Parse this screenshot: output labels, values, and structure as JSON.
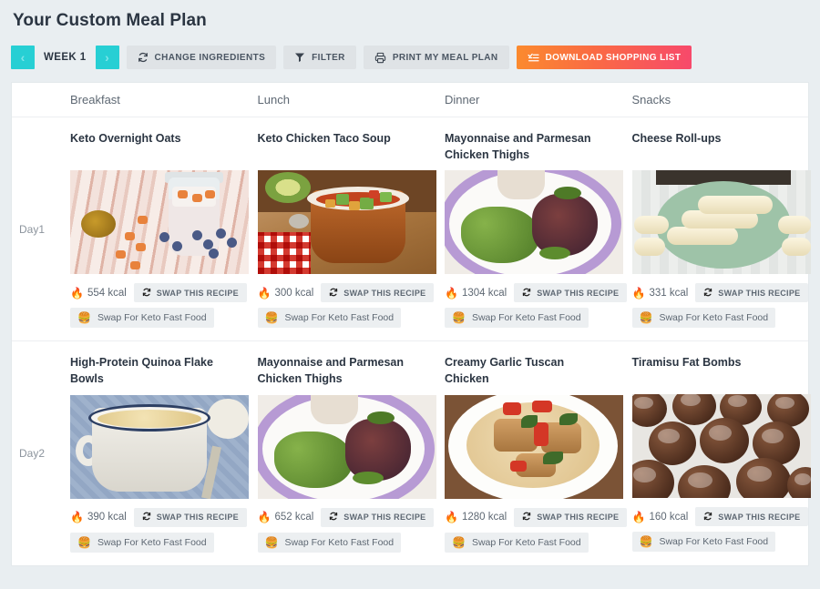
{
  "header": {
    "title": "Your Custom Meal Plan"
  },
  "toolbar": {
    "prev_label": "‹",
    "next_label": "›",
    "week_label": "WEEK 1",
    "change_ingredients_label": "CHANGE INGREDIENTS",
    "filter_label": "FILTER",
    "print_label": "PRINT MY MEAL PLAN",
    "download_label": "DOWNLOAD SHOPPING LIST",
    "accent_teal": "#27cfd4",
    "accent_gradient_start": "#fb8a2e",
    "accent_gradient_end": "#f7496b"
  },
  "columns": [
    {
      "label": "Breakfast"
    },
    {
      "label": "Lunch"
    },
    {
      "label": "Dinner"
    },
    {
      "label": "Snacks"
    }
  ],
  "labels": {
    "swap_recipe": "SWAP THIS RECIPE",
    "swap_fast_food": "Swap For Keto Fast Food",
    "kcal_unit": "kcal",
    "flame_icon": "🔥",
    "burger_icon": "🍔"
  },
  "days": [
    {
      "label_line1": "Day",
      "label_line2": "1",
      "meals": [
        {
          "title": "Keto Overnight Oats",
          "kcal": "554 kcal"
        },
        {
          "title": "Keto Chicken Taco Soup",
          "kcal": "300 kcal"
        },
        {
          "title": "Mayonnaise and Parmesan Chicken Thighs",
          "kcal": "1304 kcal"
        },
        {
          "title": "Cheese Roll-ups",
          "kcal": "331 kcal"
        }
      ]
    },
    {
      "label_line1": "Day",
      "label_line2": "2",
      "meals": [
        {
          "title": "High-Protein Quinoa Flake Bowls",
          "kcal": "390 kcal"
        },
        {
          "title": "Mayonnaise and Parmesan Chicken Thighs",
          "kcal": "652 kcal"
        },
        {
          "title": "Creamy Garlic Tuscan Chicken",
          "kcal": "1280 kcal"
        },
        {
          "title": "Tiramisu Fat Bombs",
          "kcal": "160 kcal"
        }
      ]
    }
  ]
}
